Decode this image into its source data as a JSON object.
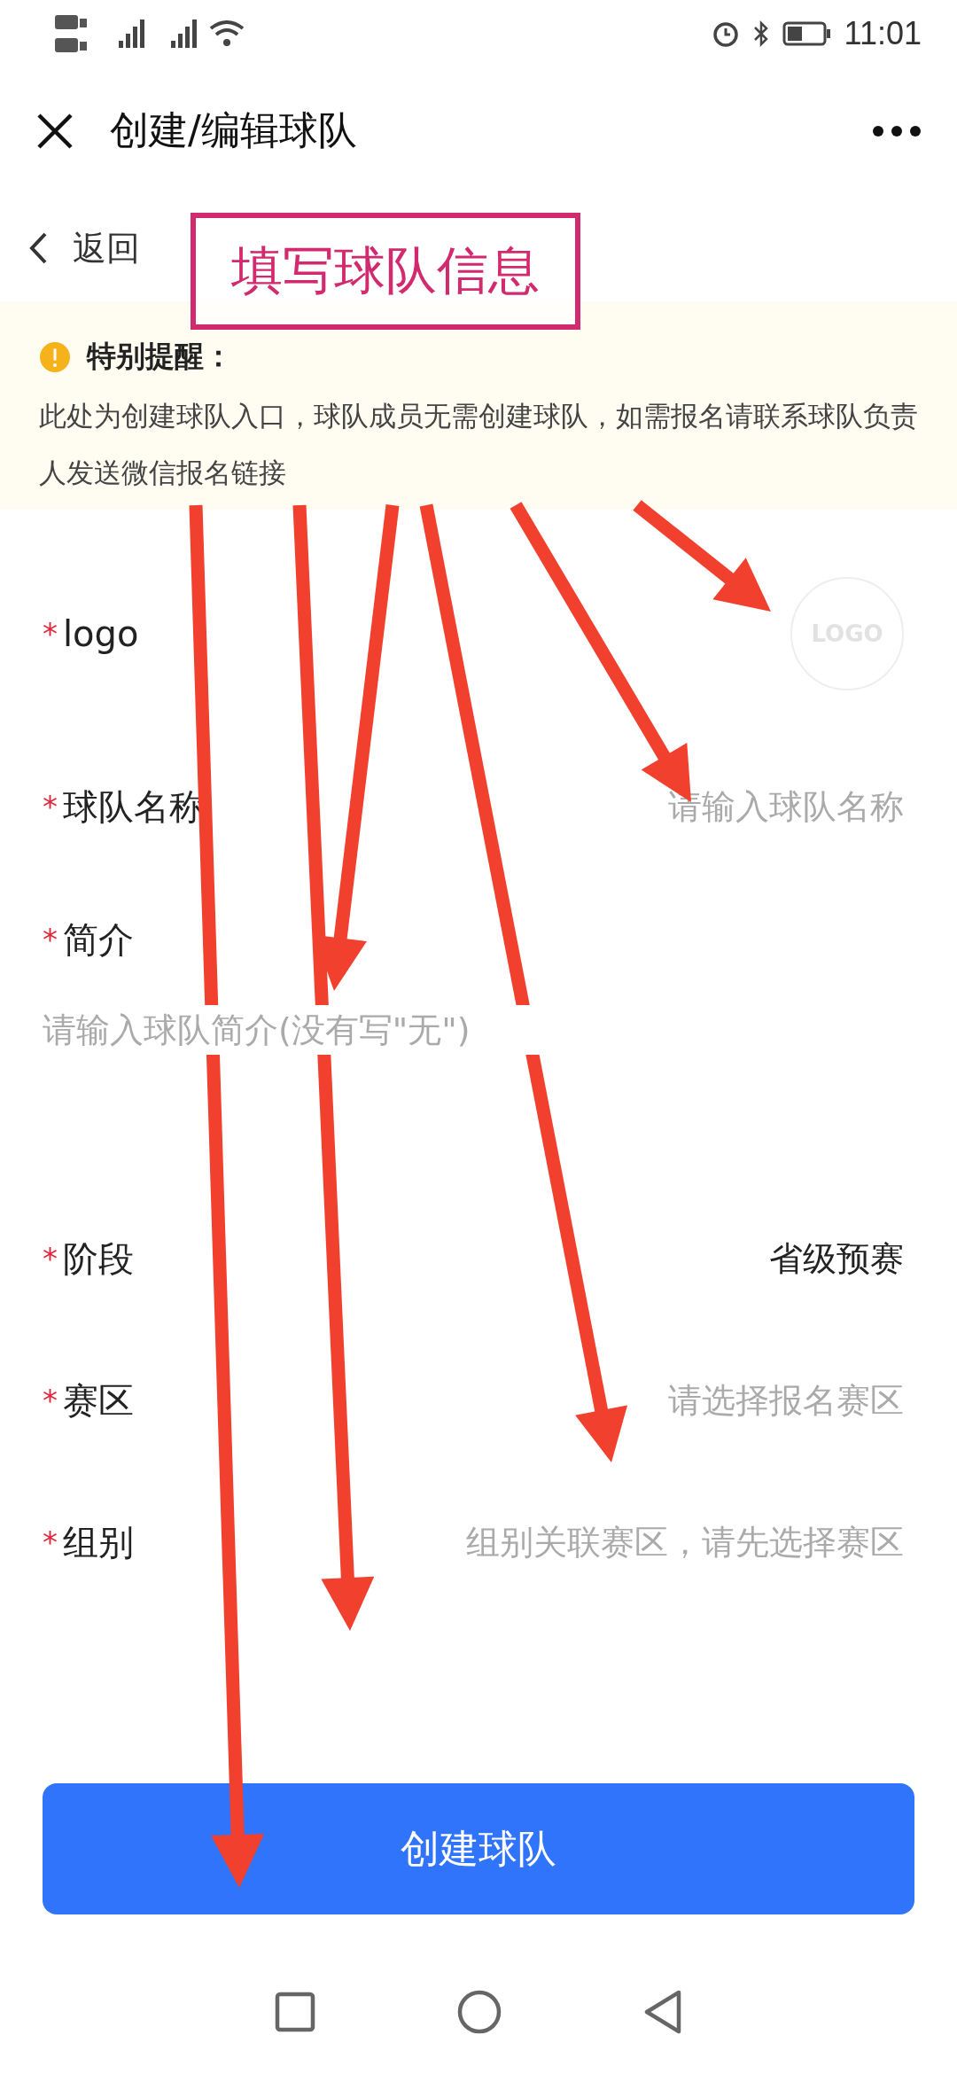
{
  "status_bar": {
    "time": "11:01"
  },
  "header": {
    "title": "创建/编辑球队"
  },
  "back": {
    "label": "返回"
  },
  "notice": {
    "title": "特别提醒：",
    "text": "此处为创建球队入口，球队成员无需创建球队，如需报名请联系球队负责人发送微信报名链接"
  },
  "form": [
    {
      "kind": "logo",
      "marker": "*",
      "label": "logo",
      "placeholder": "LOGO"
    },
    {
      "kind": "input",
      "marker": "*",
      "label": "球队名称",
      "placeholder": "请输入球队名称"
    },
    {
      "kind": "textarea",
      "marker": "*",
      "label": "简介",
      "placeholder": "请输入球队简介(没有写\"无\")"
    },
    {
      "kind": "select",
      "marker": "*",
      "label": "阶段",
      "value": "省级预赛"
    },
    {
      "kind": "select",
      "marker": "*",
      "label": "赛区",
      "placeholder": "请选择报名赛区"
    },
    {
      "kind": "select",
      "marker": "*",
      "label": "组别",
      "placeholder": "组别关联赛区，请先选择赛区"
    }
  ],
  "submit": {
    "label": "创建球队"
  },
  "annotation": {
    "label": "填写球队信息"
  }
}
